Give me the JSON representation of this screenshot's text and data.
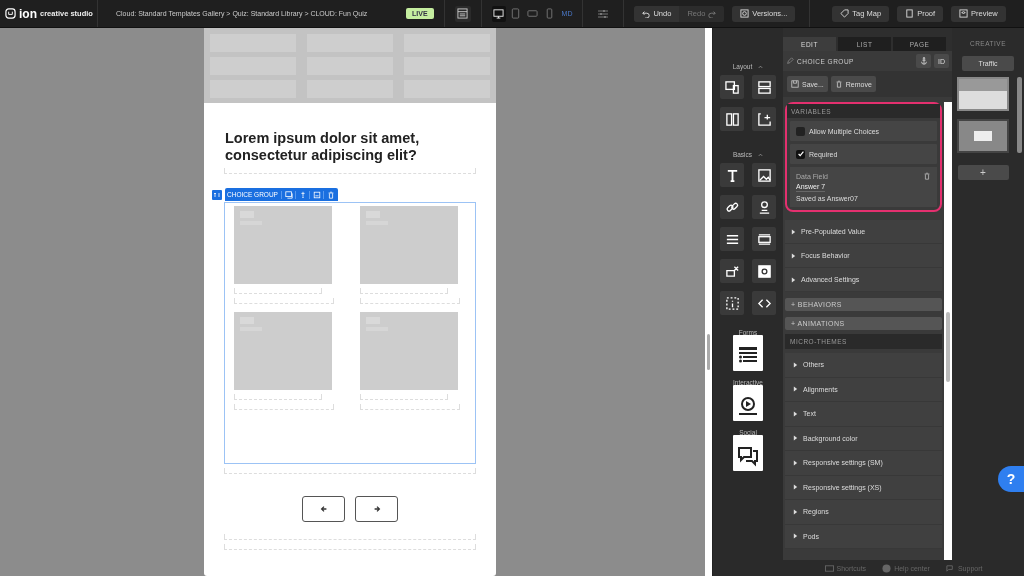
{
  "topbar": {
    "brand": "ion",
    "product": "creative studio",
    "breadcrumb": "Cloud: Standard Templates Gallery > Quiz: Standard Library > CLOUD: Fun Quiz",
    "badge": "LIVE",
    "devices": [
      {
        "kind": "desktop",
        "selected": true
      },
      {
        "kind": "tablet",
        "selected": false
      },
      {
        "kind": "tablet-landscape",
        "selected": false
      },
      {
        "kind": "phone",
        "selected": false
      }
    ],
    "size_label": "MD",
    "undo": {
      "label": "Undo",
      "disabled": false
    },
    "redo": {
      "label": "Redo",
      "disabled": true
    },
    "buttons": [
      {
        "kind": "versions",
        "label": "Versions..."
      },
      {
        "kind": "tag",
        "label": "Tag Map"
      },
      {
        "kind": "proof",
        "label": "Proof"
      },
      {
        "kind": "preview",
        "label": "Preview"
      }
    ]
  },
  "canvas": {
    "question": "Lorem ipsum dolor sit amet, consectetur adipiscing elit?",
    "choice_group": {
      "label": "CHOICE GROUP"
    }
  },
  "palette": [
    {
      "title": "Layout",
      "kind": "grid"
    },
    {
      "title": "Basics",
      "kind": "grid"
    },
    {
      "title": "Forms",
      "kind": "tile"
    },
    {
      "title": "Interactive",
      "kind": "tile"
    },
    {
      "title": "Social",
      "kind": "tile"
    }
  ],
  "tabs": [
    {
      "label": "EDIT",
      "selected": true
    },
    {
      "label": "LIST",
      "selected": false
    },
    {
      "label": "PAGE",
      "selected": false
    }
  ],
  "properties": {
    "title": "CHOICE GROUP",
    "id_button": "ID",
    "save": "Save...",
    "remove": "Remove",
    "variables": {
      "title": "VARIABLES",
      "options": [
        {
          "label": "Allow Multiple Choices",
          "checked": false
        },
        {
          "label": "Required",
          "checked": true
        }
      ],
      "data_field": {
        "label": "Data Field",
        "value": "Answer 7",
        "note": "Saved as Answer07"
      }
    },
    "settings": [
      {
        "label": "Pre-Populated Value",
        "expanded": false
      },
      {
        "label": "Focus Behavior",
        "expanded": false
      },
      {
        "label": "Advanced Settings",
        "expanded": false
      }
    ],
    "sections": [
      "+ BEHAVIORS",
      "+ ANIMATIONS"
    ],
    "micro_themes": {
      "title": "MICRO-THEMES",
      "items": [
        {
          "label": "Others",
          "expanded": false
        },
        {
          "label": "Alignments",
          "expanded": false
        },
        {
          "label": "Text",
          "expanded": false
        },
        {
          "label": "Background color",
          "expanded": false
        },
        {
          "label": "Responsive settings (SM)",
          "expanded": false
        },
        {
          "label": "Responsive settings (XS)",
          "expanded": false
        },
        {
          "label": "Regions",
          "expanded": false
        },
        {
          "label": "Pods",
          "expanded": false
        }
      ]
    }
  },
  "creative": {
    "title": "CREATIVE",
    "traffic": "Traffic",
    "pages": [
      {
        "selected": true
      },
      {
        "selected": false
      }
    ],
    "add": "+"
  },
  "help": "?",
  "footer": [
    "Shortcuts",
    "Help center",
    "Support"
  ]
}
